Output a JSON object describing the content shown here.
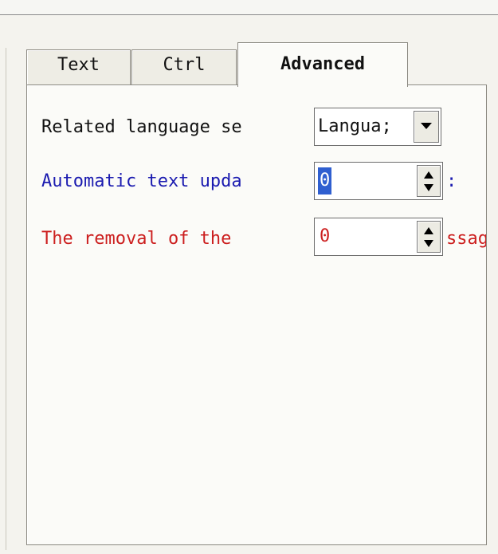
{
  "tabs": [
    {
      "label": "Text",
      "active": false
    },
    {
      "label": "Ctrl",
      "active": false
    },
    {
      "label": "Advanced",
      "active": true
    }
  ],
  "rows": {
    "language": {
      "label": "Related language se",
      "value": "Langua;"
    },
    "auto_update": {
      "label": "Automatic text upda",
      "value": "0",
      "suffix": ":"
    },
    "removal": {
      "label": "The removal of the ",
      "value": "0",
      "suffix": "ssag"
    }
  },
  "colors": {
    "blue_label": "#1b1bb0",
    "red_label": "#cc1f1f",
    "selection": "#2f5fd0"
  },
  "icons": {
    "dropdown": "chevron-down-icon",
    "spin_up": "arrow-up-icon",
    "spin_down": "arrow-down-icon"
  }
}
